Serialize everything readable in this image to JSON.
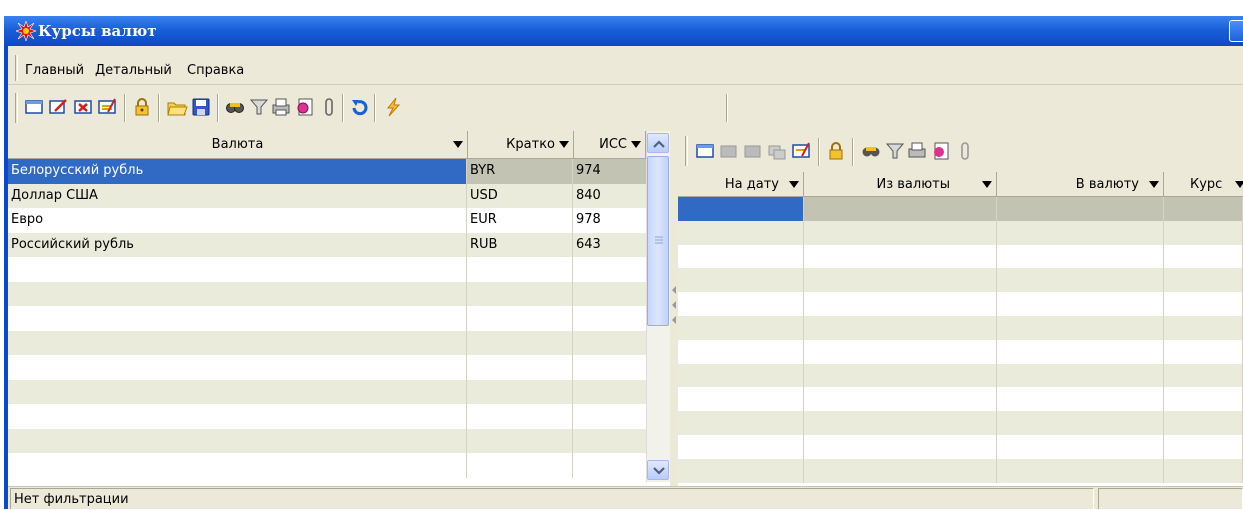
{
  "window": {
    "title": "Курсы валют"
  },
  "menu": {
    "items": [
      "Главный",
      "Детальный",
      "Справка"
    ]
  },
  "toolbar": {
    "icons": [
      "new-icon",
      "edit-icon",
      "delete-icon",
      "approve-icon",
      "lock-icon",
      "open-folder-icon",
      "save-icon",
      "find-icon",
      "filter-icon",
      "print-icon",
      "report-icon",
      "attach-icon",
      "refresh-icon",
      "lightning-icon"
    ]
  },
  "left_grid": {
    "columns": [
      "Валюта",
      "Кратко",
      "ИСС"
    ],
    "rows": [
      {
        "name": "Белорусский рубль",
        "code": "BYR",
        "num": "974"
      },
      {
        "name": "Доллар США",
        "code": "USD",
        "num": "840"
      },
      {
        "name": "Евро",
        "code": "EUR",
        "num": "978"
      },
      {
        "name": "Российский рубль",
        "code": "RUB",
        "num": "643"
      }
    ],
    "selected_row": 0
  },
  "right_grid": {
    "columns": [
      "На дату",
      "Из валюты",
      "В валюту",
      "Курс"
    ]
  },
  "status": {
    "text": "Нет фильтрации",
    "panel2": ""
  },
  "colors": {
    "selection": "#316ac5",
    "title_bar": "#0c4ac4",
    "row_alt": "#ebebdc"
  }
}
